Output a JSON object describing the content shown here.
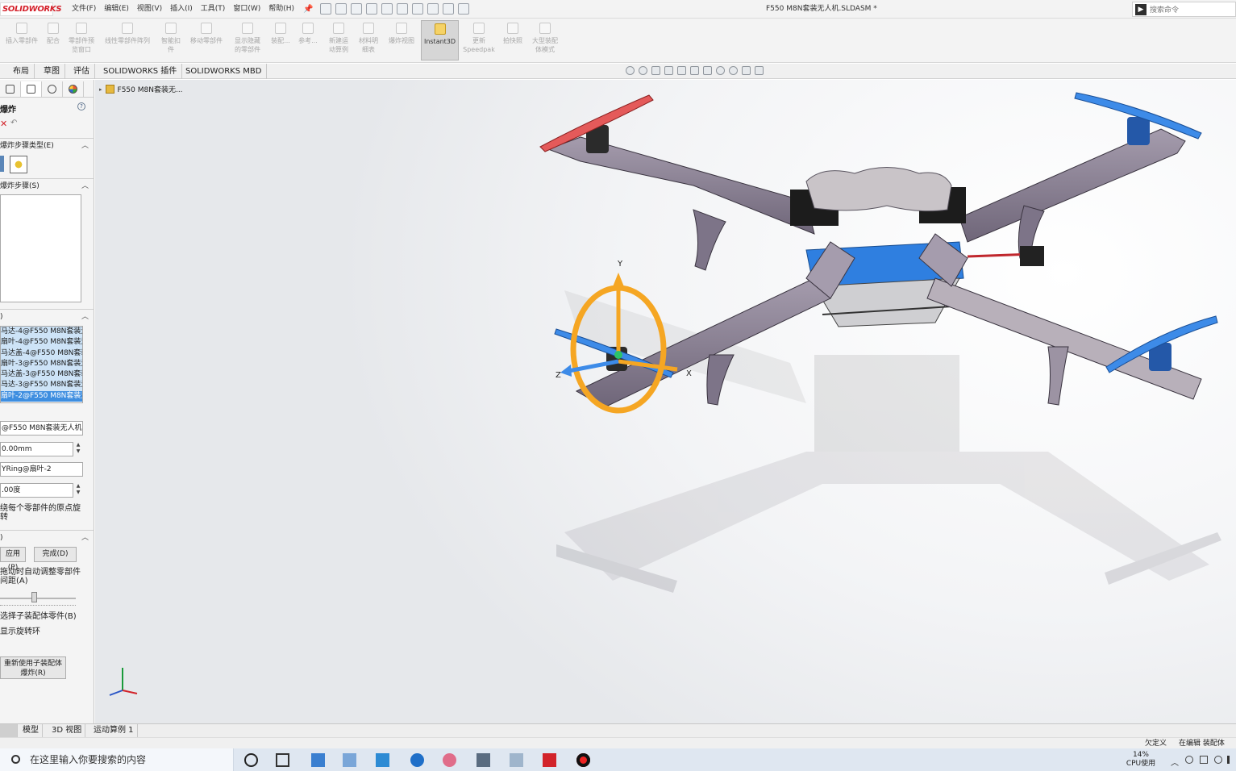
{
  "app": {
    "logo": "SOLIDWORKS",
    "doc_title": "F550 M8N套装无人机.SLDASM *",
    "search_placeholder": "搜索命令"
  },
  "menu": [
    "文件(F)",
    "编辑(E)",
    "视图(V)",
    "插入(I)",
    "工具(T)",
    "窗口(W)",
    "帮助(H)"
  ],
  "commands": [
    {
      "l1": "插入零部件",
      "l2": ""
    },
    {
      "l1": "配合",
      "l2": ""
    },
    {
      "l1": "零部件预",
      "l2": "览窗口"
    },
    {
      "l1": "线性零部件阵列",
      "l2": ""
    },
    {
      "l1": "智能扣",
      "l2": "件"
    },
    {
      "l1": "移动零部件",
      "l2": ""
    },
    {
      "l1": "显示隐藏",
      "l2": "的零部件"
    },
    {
      "l1": "装配...",
      "l2": ""
    },
    {
      "l1": "参考...",
      "l2": ""
    },
    {
      "l1": "新建运",
      "l2": "动算例"
    },
    {
      "l1": "材料明",
      "l2": "细表"
    },
    {
      "l1": "爆炸视图",
      "l2": ""
    },
    {
      "l1": "Instant3D",
      "l2": ""
    },
    {
      "l1": "更新",
      "l2": "Speedpak"
    },
    {
      "l1": "拍快照",
      "l2": ""
    },
    {
      "l1": "大型装配",
      "l2": "体模式"
    }
  ],
  "ribbon_tabs": [
    "布局",
    "草图",
    "评估",
    "SOLIDWORKS 插件",
    "SOLIDWORKS MBD"
  ],
  "property_manager": {
    "title": "爆炸",
    "section_type": "爆炸步骤类型(E)",
    "section_steps": "爆炸步骤(S)",
    "section_settings": ")",
    "components": [
      "马达-4@F550 M8N套装无",
      "扇叶-4@F550 M8N套装无",
      "马达盖-4@F550 M8N套装",
      "扇叶-3@F550 M8N套装无",
      "马达盖-3@F550 M8N套装",
      "马达-3@F550 M8N套装无",
      "扇叶-2@F550 M8N套装无"
    ],
    "direction_field": "@F550 M8N套装无人机",
    "distance_value": "0.00mm",
    "axis_field": "YRing@扇叶-2",
    "angle_value": ".00度",
    "rotate_about_origin": "绕每个零部件的原点旋转",
    "section_options": ")",
    "apply_button": "应用(P)",
    "done_button": "完成(D)",
    "auto_space": "拖动时自动调整零部件间距(A)",
    "select_sub": "选择子装配体零件(B)",
    "show_ring": "显示旋转环",
    "reuse_button": "重新使用子装配体爆炸(R)"
  },
  "tree": {
    "root": "F550 M8N套装无..."
  },
  "triad_labels": {
    "y": "Y",
    "x": "X",
    "z": "Z"
  },
  "bottom_tabs": [
    "模型",
    "3D 视图",
    "运动算例 1"
  ],
  "status": {
    "defined": "欠定义",
    "editing": "在编辑 装配体"
  },
  "taskbar": {
    "search_placeholder": "在这里输入你要搜索的内容",
    "cpu_percent": "14%",
    "cpu_label": "CPU使用"
  },
  "colors": {
    "accent_blue": "#2f7fe0",
    "red_prop": "#e45a5a",
    "frame": "#8f8798",
    "handle_orange": "#f5a623"
  }
}
